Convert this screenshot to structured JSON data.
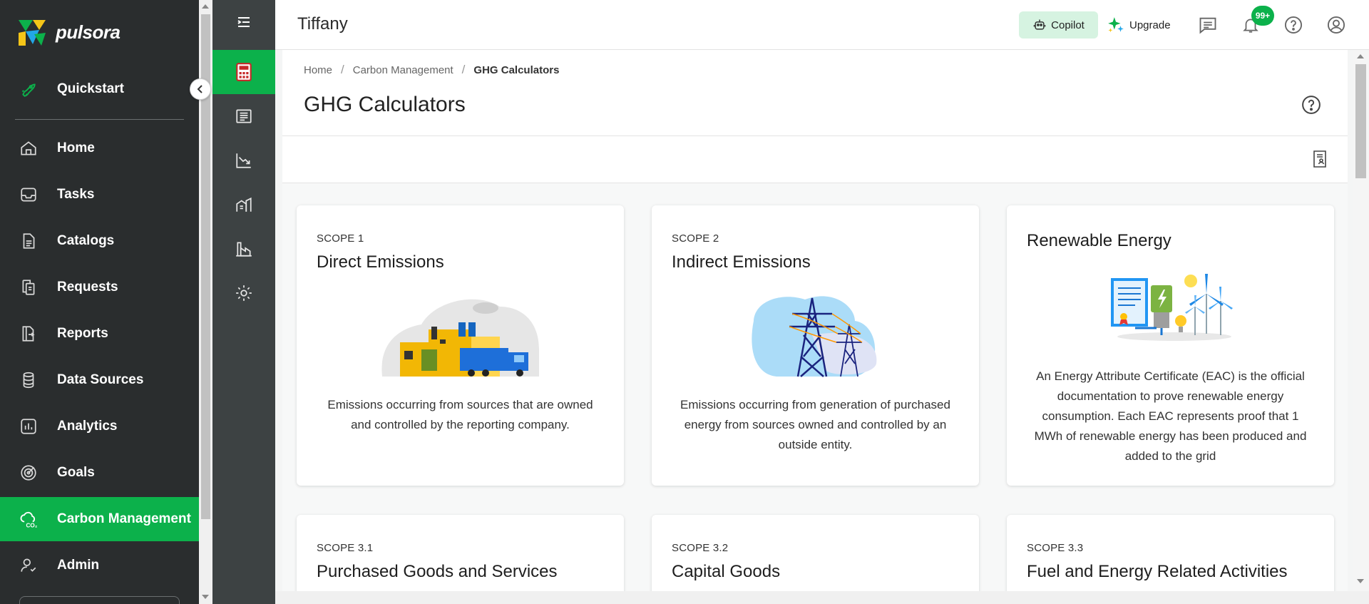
{
  "brand": {
    "name": "pulsora",
    "accent": "#0cb14b"
  },
  "sidebar": {
    "quickstart": "Quickstart",
    "items": [
      {
        "label": "Home",
        "icon": "home-icon"
      },
      {
        "label": "Tasks",
        "icon": "inbox-icon"
      },
      {
        "label": "Catalogs",
        "icon": "document-icon"
      },
      {
        "label": "Requests",
        "icon": "copy-icon"
      },
      {
        "label": "Reports",
        "icon": "report-export-icon"
      },
      {
        "label": "Data Sources",
        "icon": "database-icon"
      },
      {
        "label": "Analytics",
        "icon": "bar-chart-icon"
      },
      {
        "label": "Goals",
        "icon": "target-icon"
      },
      {
        "label": "Carbon Management",
        "icon": "cloud-co2-icon",
        "active": true
      },
      {
        "label": "Admin",
        "icon": "user-settings-icon"
      }
    ]
  },
  "rail": [
    {
      "name": "calculator-icon",
      "active": true
    },
    {
      "name": "ledger-icon"
    },
    {
      "name": "trend-down-chart-icon"
    },
    {
      "name": "buildings-icon"
    },
    {
      "name": "factory-icon"
    },
    {
      "name": "settings-gear-icon"
    }
  ],
  "header": {
    "workspace": "Tiffany",
    "copilot": "Copilot",
    "upgrade": "Upgrade",
    "notification_badge": "99+"
  },
  "breadcrumb": [
    "Home",
    "Carbon Management",
    "GHG Calculators"
  ],
  "page": {
    "title": "GHG Calculators"
  },
  "cards": [
    {
      "scope": "SCOPE 1",
      "title": "Direct Emissions",
      "description": "Emissions occurring from sources that are owned and controlled by the reporting company."
    },
    {
      "scope": "SCOPE 2",
      "title": "Indirect Emissions",
      "description": "Emissions occurring from generation of purchased energy from sources owned and controlled by an outside entity."
    },
    {
      "scope": "",
      "title": "Renewable Energy",
      "description": "An Energy Attribute Certificate (EAC) is the official documentation to prove renewable energy consumption. Each EAC represents proof that 1 MWh of renewable energy has been produced and added to the grid"
    },
    {
      "scope": "SCOPE 3.1",
      "title": "Purchased Goods and Services"
    },
    {
      "scope": "SCOPE 3.2",
      "title": "Capital Goods"
    },
    {
      "scope": "SCOPE 3.3",
      "title": "Fuel and Energy Related Activities"
    }
  ]
}
